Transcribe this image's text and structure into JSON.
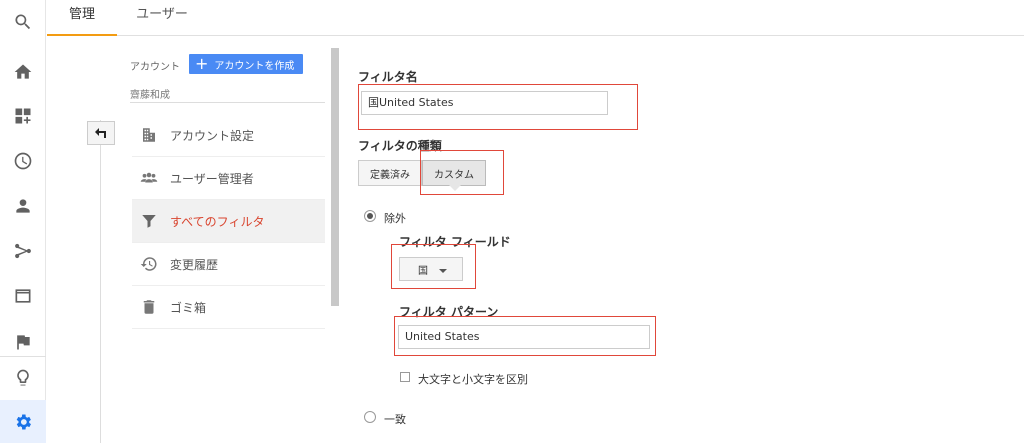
{
  "tabs": [
    {
      "label": "管理",
      "active": true
    },
    {
      "label": "ユーザー",
      "active": false
    }
  ],
  "rail": {
    "icons": [
      "search-icon",
      "home-icon",
      "dashboard-icon",
      "clock-icon",
      "person-icon",
      "fork-icon",
      "window-icon",
      "flag-icon",
      "lightbulb-icon",
      "gear-icon"
    ],
    "active": "gear-icon"
  },
  "account": {
    "label": "アカウント",
    "create_button": "アカウントを作成",
    "name": "齋藤和成"
  },
  "menu": [
    {
      "label": "アカウント設定",
      "icon": "building-icon",
      "active": false
    },
    {
      "label": "ユーザー管理者",
      "icon": "people-icon",
      "active": false
    },
    {
      "label": "すべてのフィルタ",
      "icon": "funnel-icon",
      "active": true
    },
    {
      "label": "変更履歴",
      "icon": "history-icon",
      "active": false
    },
    {
      "label": "ゴミ箱",
      "icon": "trash-icon",
      "active": false
    }
  ],
  "form": {
    "filter_name_label": "フィルタ名",
    "filter_name_value": "国United States",
    "filter_type_label": "フィルタの種類",
    "type_predefined": "定義済み",
    "type_custom": "カスタム",
    "exclude_label": "除外",
    "filter_field_label": "フィルタ フィールド",
    "filter_field_value": "国",
    "filter_pattern_label": "フィルタ パターン",
    "filter_pattern_value": "United States",
    "case_sensitive_label": "大文字と小文字を区別",
    "match_label": "一致"
  },
  "colors": {
    "accent_tab": "#f39c12",
    "active_menu_text": "#d9442e",
    "create_button": "#4a8af4",
    "highlight_box": "#e0473a",
    "active_rail": "#1a73e8"
  }
}
